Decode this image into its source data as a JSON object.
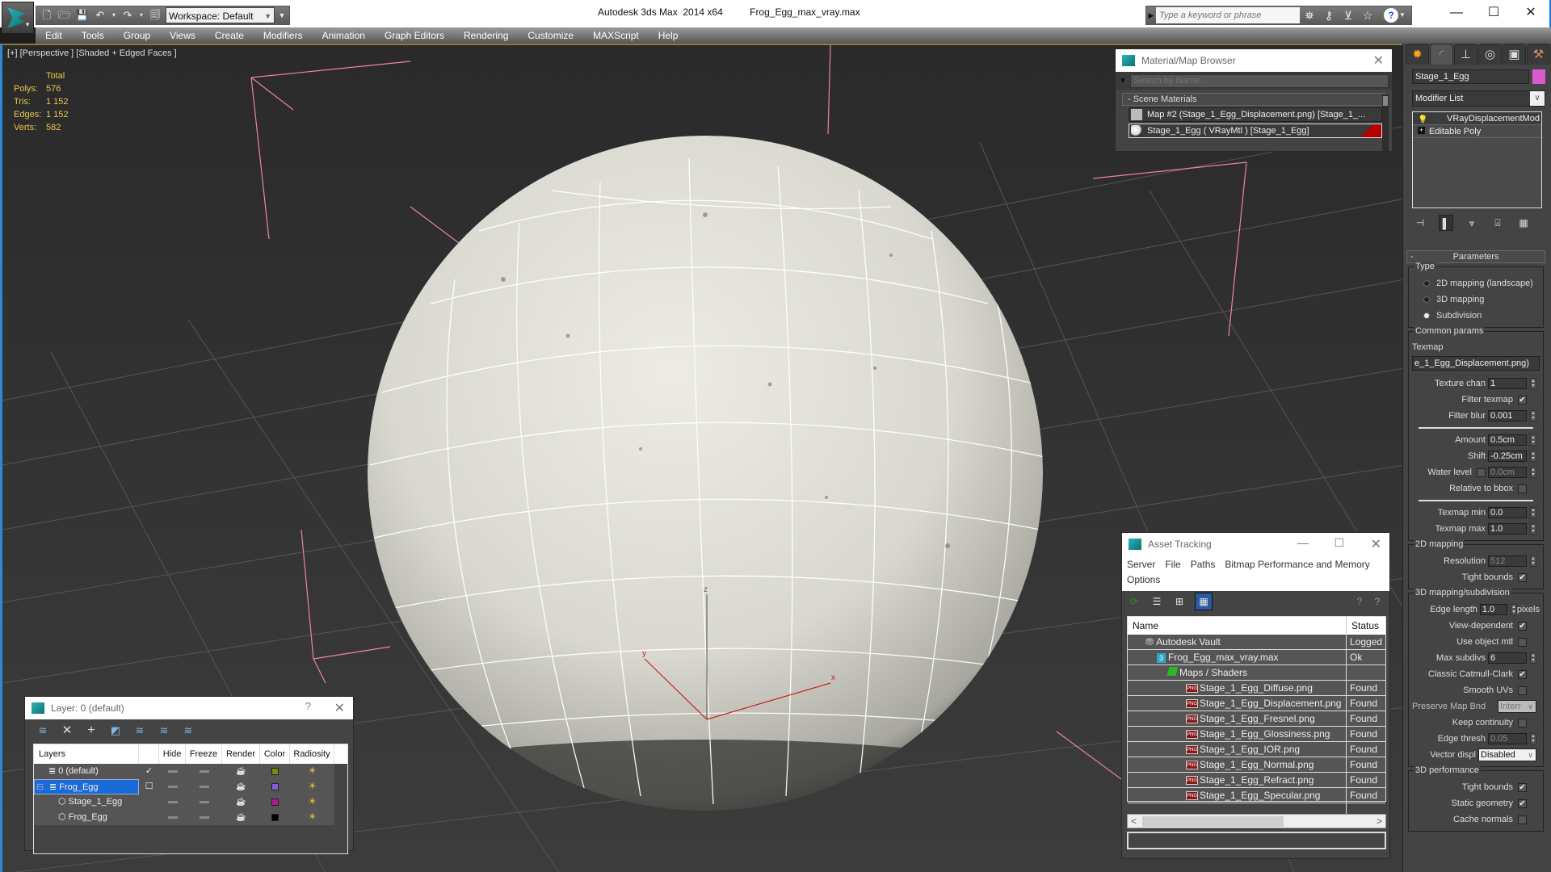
{
  "titlebar": {
    "workspace": "Workspace: Default",
    "app_title": "Autodesk 3ds Max  2014 x64",
    "file_title": "Frog_Egg_max_vray.max",
    "search_placeholder": "Type a keyword or phrase",
    "quick_access_icons": [
      "new-file-icon",
      "open-folder-icon",
      "save-icon",
      "undo-icon",
      "redo-icon",
      "project-folder-icon"
    ],
    "help_icons": [
      "binoculars-icon",
      "key-icon",
      "satellite-icon",
      "star-icon",
      "help-icon"
    ],
    "window_controls": {
      "minimize": "—",
      "maximize": "☐",
      "close": "✕"
    }
  },
  "menubar": {
    "items": [
      "Edit",
      "Tools",
      "Group",
      "Views",
      "Create",
      "Modifiers",
      "Animation",
      "Graph Editors",
      "Rendering",
      "Customize",
      "MAXScript",
      "Help"
    ]
  },
  "viewport": {
    "label": "[+] [Perspective ] [Shaded + Edged Faces ]",
    "stats": {
      "header": "Total",
      "rows": [
        {
          "key": "Polys:",
          "value": "576"
        },
        {
          "key": "Tris:",
          "value": "1 152"
        },
        {
          "key": "Edges:",
          "value": "1 152"
        },
        {
          "key": "Verts:",
          "value": "582"
        }
      ]
    },
    "gizmo": {
      "x": "x",
      "y": "y",
      "z": "z"
    }
  },
  "material_browser": {
    "title": "Material/Map Browser",
    "search_placeholder": "Search by Name ...",
    "section": "- Scene Materials",
    "items": [
      {
        "label": "Map #2 (Stage_1_Egg_Displacement.png) [Stage_1_...",
        "selected": false
      },
      {
        "label": "Stage_1_Egg  ( VRayMtl ) [Stage_1_Egg]",
        "selected": true
      }
    ]
  },
  "command_panel": {
    "tabs": [
      "create-tab",
      "modify-tab",
      "hierarchy-tab",
      "motion-tab",
      "display-tab",
      "utilities-tab"
    ],
    "object_name": "Stage_1_Egg",
    "object_color": "#d85ccc",
    "modifier_list": "Modifier List",
    "stack": [
      "VRayDisplacementMod",
      "Editable Poly"
    ],
    "parameters": {
      "title": "Parameters",
      "type_label": "Type",
      "types": [
        {
          "label": "2D mapping (landscape)",
          "selected": false
        },
        {
          "label": "3D mapping",
          "selected": false
        },
        {
          "label": "Subdivision",
          "selected": true
        }
      ],
      "common_label": "Common params",
      "texmap_label": "Texmap",
      "texmap_value": "e_1_Egg_Displacement.png)",
      "texture_chan": {
        "label": "Texture chan",
        "value": "1"
      },
      "filter_texmap": {
        "label": "Filter texmap",
        "checked": true
      },
      "filter_blur": {
        "label": "Filter blur",
        "value": "0.001"
      },
      "amount": {
        "label": "Amount",
        "value": "0.5cm"
      },
      "shift": {
        "label": "Shift",
        "value": "-0.25cm"
      },
      "water_level": {
        "label": "Water level",
        "value": "0.0cm",
        "checked": false
      },
      "relative_bbox": {
        "label": "Relative to bbox",
        "checked": false
      },
      "texmap_min": {
        "label": "Texmap min",
        "value": "0.0"
      },
      "texmap_max": {
        "label": "Texmap max",
        "value": "1.0"
      },
      "mapping2d_label": "2D mapping",
      "resolution": {
        "label": "Resolution",
        "value": "512"
      },
      "tight_bounds_2d": {
        "label": "Tight bounds",
        "checked": true
      },
      "mapping3d_label": "3D mapping/subdivision",
      "edge_length": {
        "label": "Edge length",
        "value": "1.0",
        "unit": "pixels"
      },
      "view_dependent": {
        "label": "View-dependent",
        "checked": true
      },
      "use_object_mtl": {
        "label": "Use object mtl",
        "checked": false
      },
      "max_subdivs": {
        "label": "Max subdivs",
        "value": "6"
      },
      "catmull_clark": {
        "label": "Classic Catmull-Clark",
        "checked": true
      },
      "smooth_uvs": {
        "label": "Smooth UVs",
        "checked": false
      },
      "preserve_map_bnd": {
        "label": "Preserve Map Bnd",
        "value": "Interr"
      },
      "keep_continuity": {
        "label": "Keep continuity",
        "checked": false
      },
      "edge_thresh": {
        "label": "Edge thresh",
        "value": "0.05"
      },
      "vector_displ": {
        "label": "Vector displ",
        "value": "Disabled"
      },
      "perf_label": "3D performance",
      "tight_bounds_3d": {
        "label": "Tight bounds",
        "checked": true
      },
      "static_geometry": {
        "label": "Static geometry",
        "checked": true
      },
      "cache_normals": {
        "label": "Cache normals",
        "checked": false
      }
    }
  },
  "asset_tracking": {
    "title": "Asset Tracking",
    "menu": [
      "Server",
      "File",
      "Paths",
      "Bitmap Performance and Memory",
      "Options"
    ],
    "columns": [
      "Name",
      "Status"
    ],
    "rows": [
      {
        "name": "Autodesk Vault",
        "status": "Logged",
        "level": 0,
        "icon": "vault-icon"
      },
      {
        "name": "Frog_Egg_max_vray.max",
        "status": "Ok",
        "level": 1,
        "icon": "max-file-icon"
      },
      {
        "name": "Maps / Shaders",
        "status": "",
        "level": 2,
        "icon": "maps-icon"
      },
      {
        "name": "Stage_1_Egg_Diffuse.png",
        "status": "Found",
        "level": 3,
        "icon": "png-icon"
      },
      {
        "name": "Stage_1_Egg_Displacement.png",
        "status": "Found",
        "level": 3,
        "icon": "png-icon"
      },
      {
        "name": "Stage_1_Egg_Fresnel.png",
        "status": "Found",
        "level": 3,
        "icon": "png-icon"
      },
      {
        "name": "Stage_1_Egg_Glossiness.png",
        "status": "Found",
        "level": 3,
        "icon": "png-icon"
      },
      {
        "name": "Stage_1_Egg_IOR.png",
        "status": "Found",
        "level": 3,
        "icon": "png-icon"
      },
      {
        "name": "Stage_1_Egg_Normal.png",
        "status": "Found",
        "level": 3,
        "icon": "png-icon"
      },
      {
        "name": "Stage_1_Egg_Refract.png",
        "status": "Found",
        "level": 3,
        "icon": "png-icon"
      },
      {
        "name": "Stage_1_Egg_Specular.png",
        "status": "Found",
        "level": 3,
        "icon": "png-icon"
      }
    ]
  },
  "layer_dialog": {
    "title": "Layer: 0 (default)",
    "help": "?",
    "columns": [
      "Layers",
      "",
      "Hide",
      "Freeze",
      "Render",
      "Color",
      "Radiosity"
    ],
    "rows": [
      {
        "name": "0 (default)",
        "active": "✓",
        "color": "#7a8a10",
        "level": 0,
        "kind": "layer",
        "selected": false
      },
      {
        "name": "Frog_Egg",
        "active": "☐",
        "color": "#8a5ad8",
        "level": 0,
        "kind": "layer",
        "selected": true
      },
      {
        "name": "Stage_1_Egg",
        "active": "",
        "color": "#b01a8a",
        "level": 1,
        "kind": "object",
        "selected": false
      },
      {
        "name": "Frog_Egg",
        "active": "",
        "color": "#000000",
        "level": 1,
        "kind": "object",
        "selected": false
      }
    ]
  }
}
